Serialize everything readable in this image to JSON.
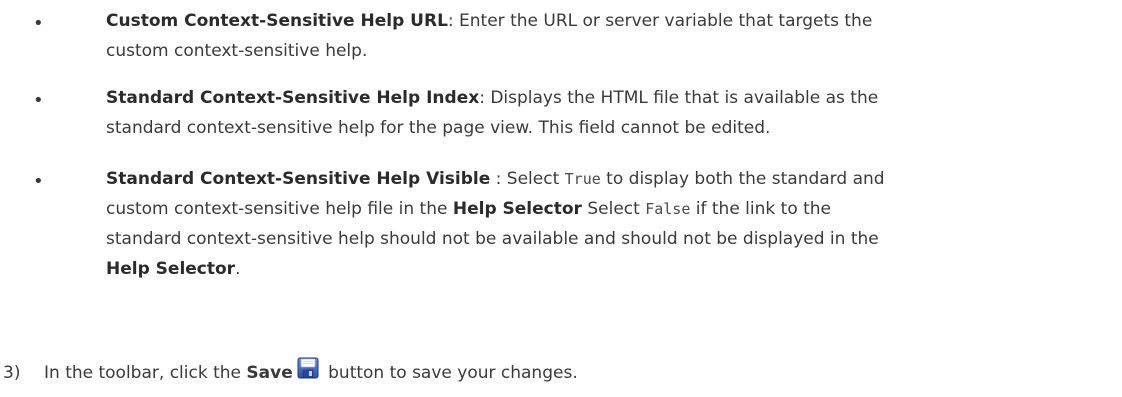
{
  "items": [
    {
      "term": "Custom Context-Sensitive Help URL",
      "text_a": ": Enter the URL or server variable that targets the",
      "text_b": "custom context-sensitive help."
    },
    {
      "term": "Standard Context-Sensitive Help Index",
      "text_a": ": Displays the HTML file that is available as the",
      "text_b": "standard context-sensitive help for the page view. This field cannot be edited."
    },
    {
      "term": "Standard Context-Sensitive Help Visible",
      "text_a": " : Select ",
      "code_true": "True",
      "text_b": " to display both the standard and",
      "text_c": "custom context-sensitive help file in the ",
      "help_selector_1": "Help Selector",
      "text_d": " Select ",
      "code_false": "False",
      "text_e": " if the link to the",
      "text_f": "standard context-sensitive help should not be available and should not be displayed in the",
      "help_selector_2": "Help Selector",
      "text_g": "."
    }
  ],
  "bullet_symbol": "•",
  "step": {
    "number": "3)",
    "text_a": "In the toolbar, click the ",
    "save_label": "Save",
    "icon": "save-disk-icon",
    "text_b": " button to save your changes."
  }
}
